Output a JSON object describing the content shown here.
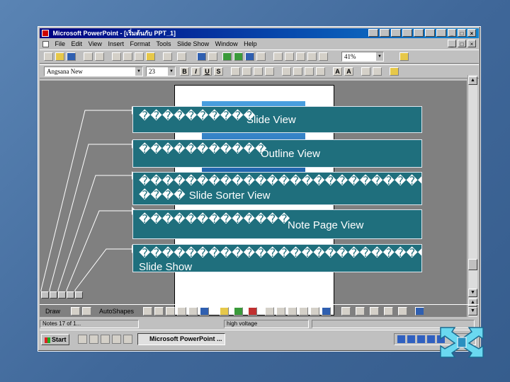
{
  "window": {
    "title": "Microsoft PowerPoint - [เริ่มต้นกับ PPT_1]"
  },
  "menu": {
    "items": [
      "File",
      "Edit",
      "View",
      "Insert",
      "Format",
      "Tools",
      "Slide Show",
      "Window",
      "Help"
    ]
  },
  "toolbar": {
    "zoom": "41%"
  },
  "formatting": {
    "font_name": "Angsana New",
    "font_size": "23"
  },
  "drawing": {
    "draw_label": "Draw",
    "autoshapes_label": "AutoShapes"
  },
  "statusbar": {
    "slide_position": "Notes 17 of 1...",
    "design_name": "high voltage"
  },
  "taskbar": {
    "start_label": "Start",
    "task_label": "Microsoft PowerPoint ..."
  },
  "callouts": [
    {
      "thai": "����������",
      "english": "Slide View"
    },
    {
      "thai": "�����������",
      "english": "Outline View"
    },
    {
      "thai": "���������������������������",
      "english": "Slide Sorter View",
      "thai2": "����"
    },
    {
      "thai": "�������������",
      "english": "Note Page View"
    },
    {
      "thai": "���������������������������",
      "english": "Slide Show"
    }
  ],
  "colors": {
    "callout_fill": "#1f6f7d",
    "background": "#3f6799",
    "titlebar": "#000080"
  }
}
